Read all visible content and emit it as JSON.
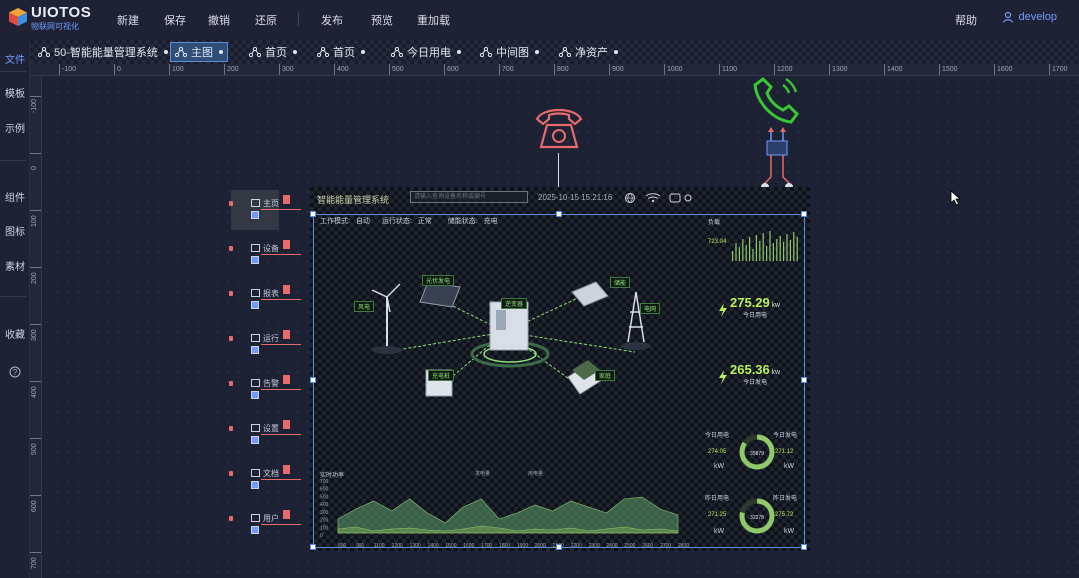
{
  "app": {
    "logo_title": "UIOTOS",
    "logo_sub": "物联网可视化",
    "menu": [
      "新建",
      "保存",
      "撤销",
      "还原",
      "发布",
      "预览",
      "重加载"
    ],
    "help": "帮助",
    "user": "develop"
  },
  "leftnav": [
    "文件",
    "模板",
    "示例",
    "组件",
    "图标",
    "素材",
    "收藏"
  ],
  "tabs": [
    {
      "label": "50-智能能量管理系统"
    },
    {
      "label": "主图",
      "active": true
    },
    {
      "label": "首页"
    },
    {
      "label": "首页"
    },
    {
      "label": "今日用电"
    },
    {
      "label": "中间图"
    },
    {
      "label": "净资产"
    }
  ],
  "hruler": [
    "-100",
    "0",
    "100",
    "200",
    "300",
    "400",
    "500",
    "600",
    "700",
    "800",
    "900",
    "1000",
    "1100",
    "1200",
    "1300",
    "1400",
    "1500",
    "1600",
    "1700"
  ],
  "vruler": [
    "-100",
    "0",
    "100",
    "200",
    "300",
    "400",
    "500",
    "600",
    "700"
  ],
  "screen": {
    "title": "智能能量管理系统",
    "search_placeholder": "请输入查询设备名称或编号",
    "time": "2025-10-15  15:21:16",
    "status": {
      "mode_label": "工作模式:",
      "mode_value": "自动",
      "run_label": "运行状态:",
      "run_value": "正常",
      "store_label": "储能状态:",
      "store_value": "充电"
    },
    "nodes": {
      "solar": "光伏发电",
      "storage": "储能",
      "load": "负载",
      "wind": "风电",
      "grid": "电网",
      "charger": "充电桩",
      "home": "家庭",
      "center": "逆变器"
    },
    "side": {
      "bars_label": "负载",
      "bars_value": "723.04",
      "today_use_value": "275.29",
      "today_use_unit": "kw",
      "today_use_label": "今日用电",
      "today_gen_value": "265.36",
      "today_gen_unit": "kw",
      "today_gen_label": "今日发电",
      "ring1_left_label": "今日用电",
      "ring1_left_value": "274.05",
      "ring1_right_label": "今日发电",
      "ring1_right_value": "271.12",
      "ring1_center": "35879",
      "ring2_left_label": "昨日用电",
      "ring2_left_value": "271.25",
      "ring2_right_label": "昨日发电",
      "ring2_right_value": "275.72",
      "ring2_center": "32278",
      "kw": "kW"
    },
    "area_chart": {
      "title": "实时功率",
      "legend": [
        "发电量",
        "用电量"
      ],
      "y_ticks": [
        "700",
        "600",
        "500",
        "400",
        "300",
        "200",
        "100",
        "0"
      ],
      "x_ticks": [
        "800",
        "900",
        "1100",
        "1200",
        "1300",
        "1400",
        "1500",
        "1600",
        "1700",
        "1800",
        "1900",
        "2000",
        "2100",
        "2200",
        "2300",
        "2400",
        "2500",
        "2600",
        "2700",
        "2800"
      ]
    },
    "left_items": [
      "主页",
      "设备",
      "报表",
      "运行",
      "告警",
      "设置",
      "文档",
      "用户"
    ]
  },
  "colors": {
    "accent": "#6f9bff",
    "green_value": "#b9f15b",
    "phone_red": "#e86a6a",
    "phone_green": "#39c733"
  }
}
